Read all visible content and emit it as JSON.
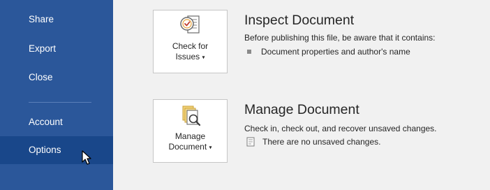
{
  "sidebar": {
    "items": [
      {
        "label": "Share"
      },
      {
        "label": "Export"
      },
      {
        "label": "Close"
      },
      {
        "label": "Account"
      },
      {
        "label": "Options"
      }
    ]
  },
  "inspect": {
    "button_line1": "Check for",
    "button_line2": "Issues",
    "title": "Inspect Document",
    "description": "Before publishing this file, be aware that it contains:",
    "bullet": "Document properties and author's name"
  },
  "manage": {
    "button_line1": "Manage",
    "button_line2": "Document",
    "title": "Manage Document",
    "description": "Check in, check out, and recover unsaved changes.",
    "status": "There are no unsaved changes."
  },
  "caret_glyph": "▾",
  "colors": {
    "sidebar_bg": "#2b579a",
    "sidebar_selected": "#19478a",
    "content_bg": "#f1f1f1"
  }
}
